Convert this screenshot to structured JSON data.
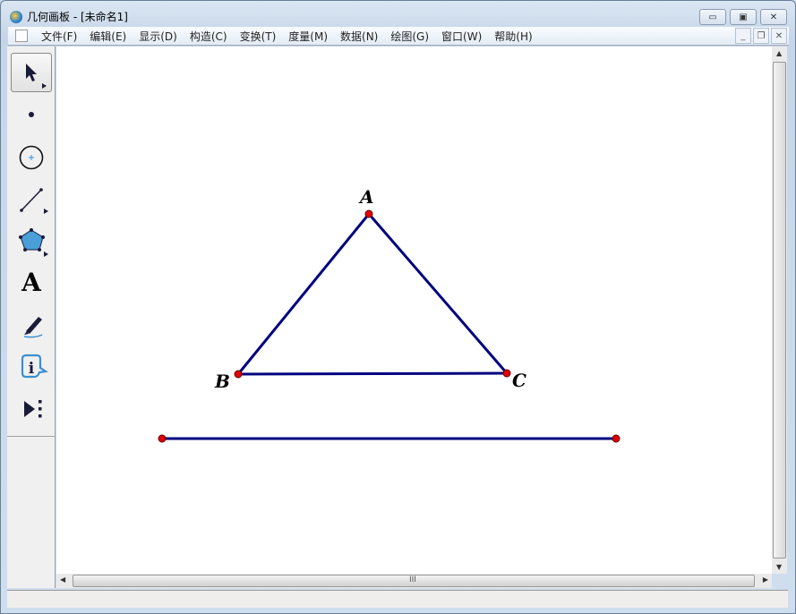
{
  "window": {
    "title": "几何画板 - [未命名1]"
  },
  "menu": [
    "文件(F)",
    "编辑(E)",
    "显示(D)",
    "构造(C)",
    "变换(T)",
    "度量(M)",
    "数据(N)",
    "绘图(G)",
    "窗口(W)",
    "帮助(H)"
  ],
  "tools": [
    "arrow-tool",
    "point-tool",
    "compass-tool",
    "straightedge-tool",
    "polygon-tool",
    "text-tool",
    "marker-tool",
    "information-tool",
    "custom-tool"
  ],
  "tool_text": "A",
  "sketch": {
    "points": {
      "A": "A",
      "B": "B",
      "C": "C"
    },
    "segment_color": "#000080",
    "point_color": "#e00000"
  },
  "scroll_grip": "III"
}
